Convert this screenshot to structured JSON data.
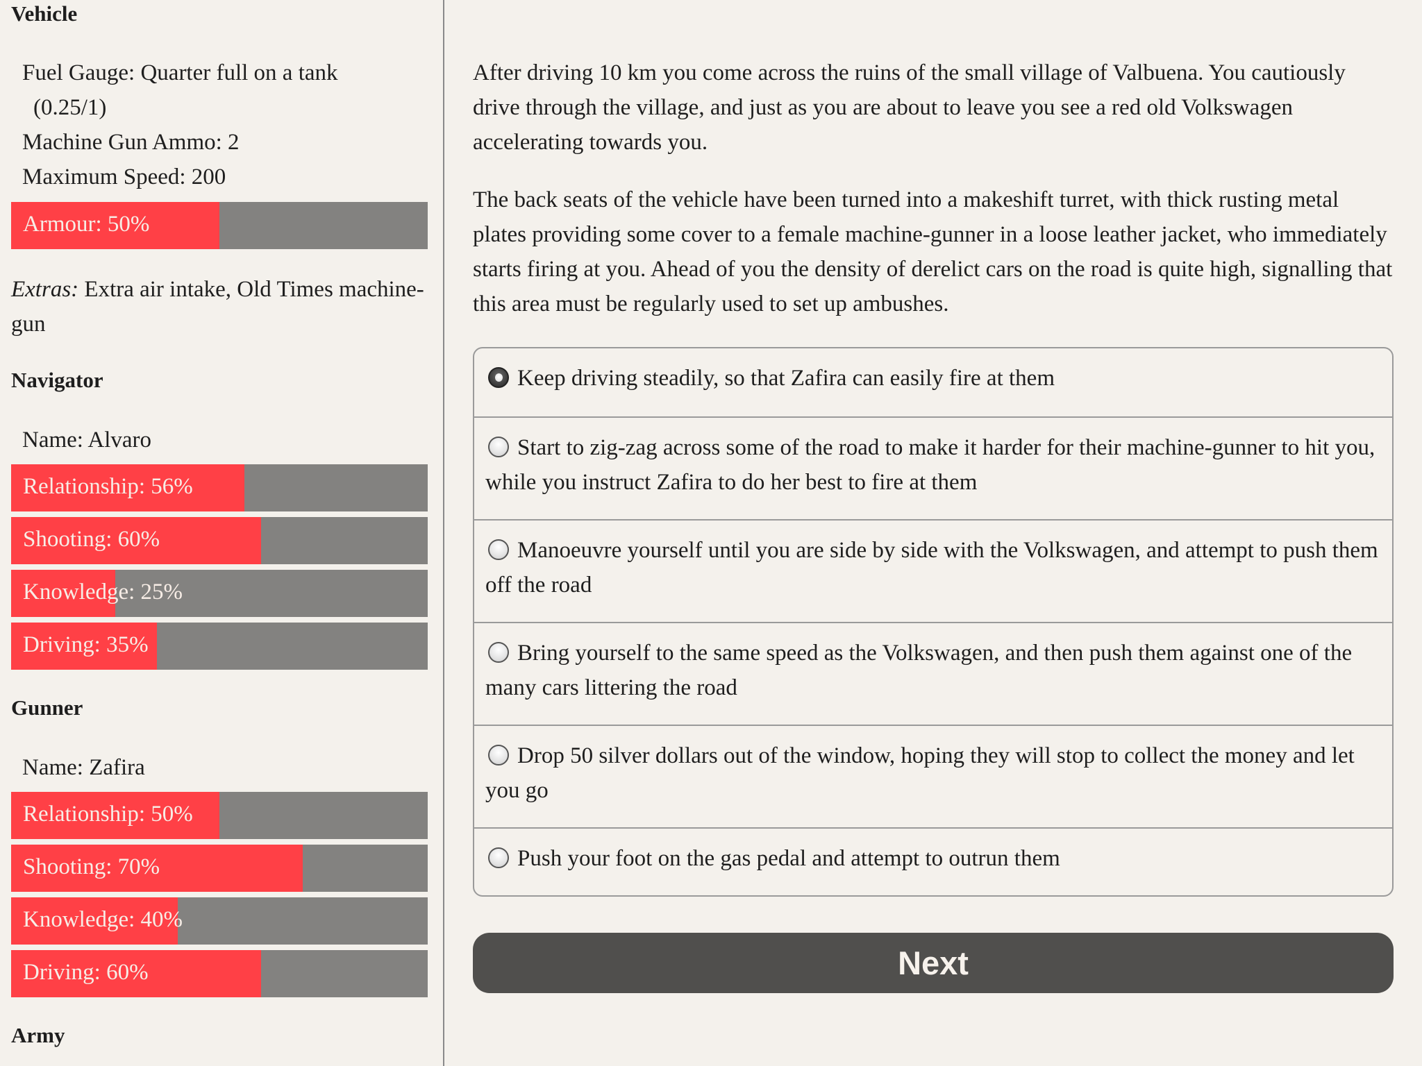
{
  "sidebar": {
    "vehicle": {
      "title": "Vehicle",
      "fuel_line1": "Fuel Gauge: Quarter full on a tank",
      "fuel_line2": "(0.25/1)",
      "fuel_fraction": 0.25,
      "ammo": "Machine Gun Ammo: 2",
      "max_speed": "Maximum Speed: 200",
      "armour": {
        "label": "Armour: 50%",
        "percent": 50
      },
      "extras_label": "Extras:",
      "extras_value": " Extra air intake, Old Times machine-gun"
    },
    "navigator": {
      "title": "Navigator",
      "name": "Name: Alvaro",
      "stats": [
        {
          "label": "Relationship: 56%",
          "percent": 56
        },
        {
          "label": "Shooting: 60%",
          "percent": 60
        },
        {
          "label": "Knowledge: 25%",
          "percent": 25
        },
        {
          "label": "Driving: 35%",
          "percent": 35
        }
      ]
    },
    "gunner": {
      "title": "Gunner",
      "name": "Name: Zafira",
      "stats": [
        {
          "label": "Relationship: 50%",
          "percent": 50
        },
        {
          "label": "Shooting: 70%",
          "percent": 70
        },
        {
          "label": "Knowledge: 40%",
          "percent": 40
        },
        {
          "label": "Driving: 60%",
          "percent": 60
        }
      ]
    },
    "army": {
      "title": "Army"
    }
  },
  "main": {
    "paragraphs": [
      "After driving 10 km you come across the ruins of the small village of Valbuena. You cautiously drive through the village, and just as you are about to leave you see a red old Volkswagen accelerating towards you.",
      "The back seats of the vehicle have been turned into a makeshift turret, with thick rusting metal plates providing some cover to a female machine-gunner in a loose leather jacket, who immediately starts firing at you. Ahead of you the density of derelict cars on the road is quite high, signalling that this area must be regularly used to set up ambushes."
    ],
    "choices": [
      {
        "text": "Keep driving steadily, so that Zafira can easily fire at them",
        "selected": true
      },
      {
        "text": "Start to zig-zag across some of the road to make it harder for their machine-gunner to hit you, while you instruct Zafira to do her best to fire at them",
        "selected": false
      },
      {
        "text": "Manoeuvre yourself until you are side by side with the Volkswagen, and attempt to push them off the road",
        "selected": false
      },
      {
        "text": "Bring yourself to the same speed as the Volkswagen, and then push them against one of the many cars littering the road",
        "selected": false
      },
      {
        "text": "Drop 50 silver dollars out of the window, hoping they will stop to collect the money and let you go",
        "selected": false
      },
      {
        "text": "Push your foot on the gas pedal and attempt to outrun them",
        "selected": false
      }
    ],
    "next_label": "Next"
  },
  "colors": {
    "background": "#f4f1ec",
    "bar_fill": "#ff4046",
    "bar_track": "#838280",
    "button": "#504f4d"
  }
}
